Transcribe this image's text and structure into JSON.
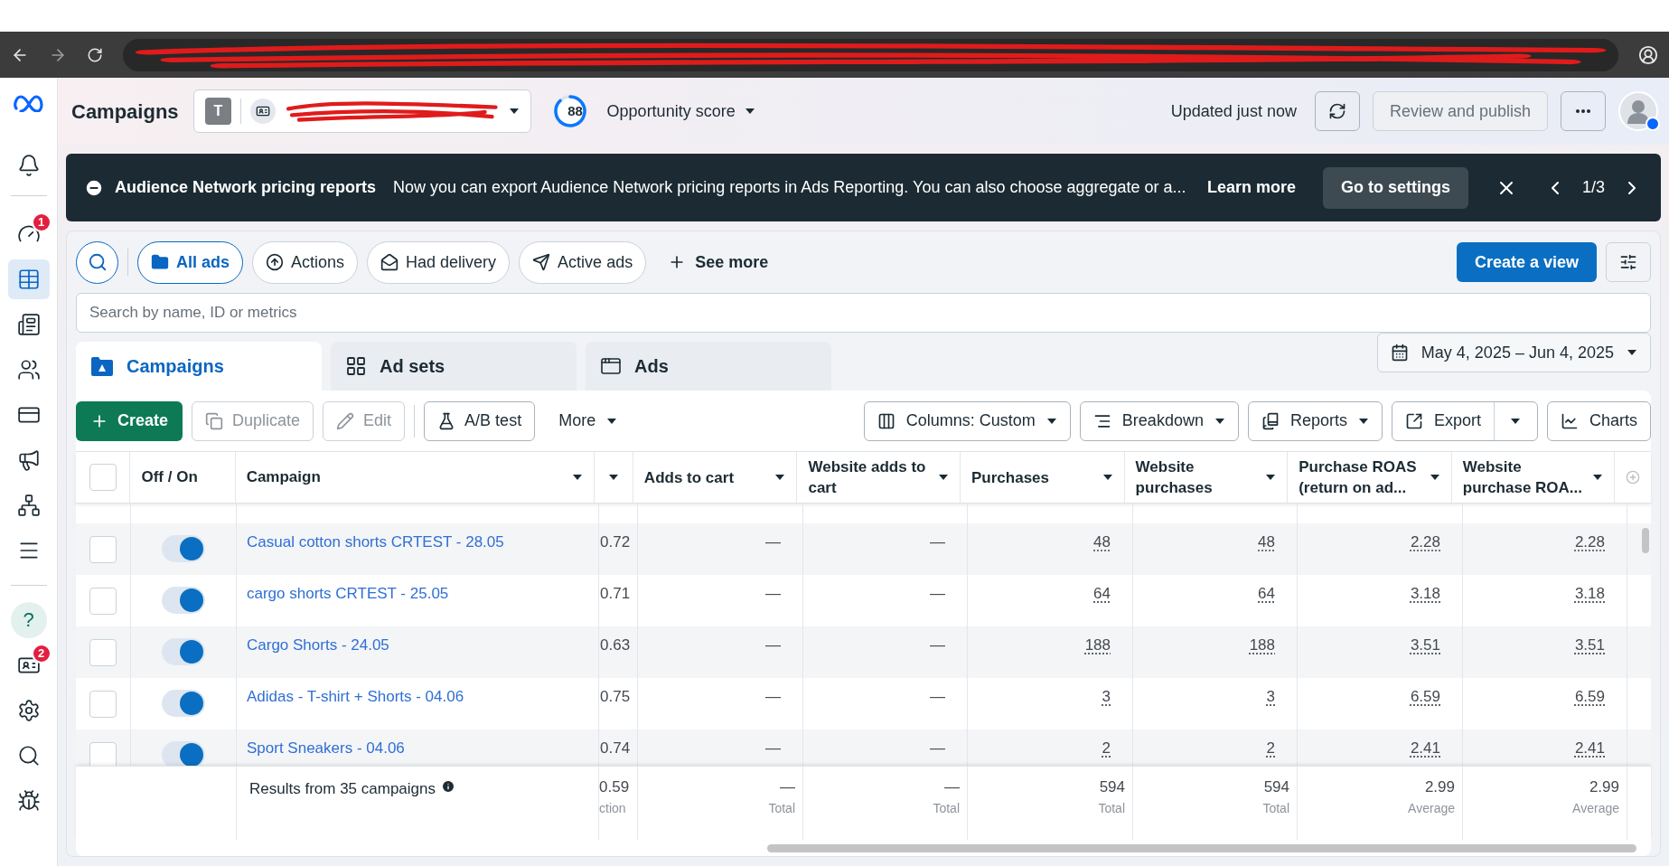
{
  "header": {
    "title": "Campaigns",
    "account": {
      "initial": "T"
    },
    "opportunity": {
      "score": "88",
      "level": 0.88,
      "label": "Opportunity score"
    },
    "updated": "Updated just now",
    "review_button": "Review and publish"
  },
  "sidebar": {
    "items": [
      {
        "kind": "gauge",
        "selected": false,
        "badge": "1"
      },
      {
        "kind": "table",
        "selected": true
      },
      {
        "kind": "pages",
        "selected": false
      },
      {
        "kind": "people",
        "selected": false
      },
      {
        "kind": "card",
        "selected": false
      },
      {
        "kind": "megaphone",
        "selected": false
      },
      {
        "kind": "network",
        "selected": false
      },
      {
        "kind": "menu",
        "selected": false
      }
    ],
    "bottom_items": [
      {
        "kind": "help",
        "selected": false,
        "glyph": "?"
      },
      {
        "kind": "news",
        "selected": false,
        "badge": "2"
      },
      {
        "kind": "settings",
        "selected": false
      },
      {
        "kind": "search",
        "selected": false
      },
      {
        "kind": "bug",
        "selected": false
      }
    ]
  },
  "banner": {
    "title": "Audience Network pricing reports",
    "message": "Now you can export Audience Network pricing reports in Ads Reporting. You can also choose aggregate or a...",
    "link": "Learn more",
    "button": "Go to settings",
    "pager": "1/3"
  },
  "filters": [
    {
      "kind": "folder",
      "label": "All ads",
      "selected": true
    },
    {
      "kind": "actions",
      "label": "Actions",
      "selected": false
    },
    {
      "kind": "delivery",
      "label": "Had delivery",
      "selected": false
    },
    {
      "kind": "active",
      "label": "Active ads",
      "selected": false
    }
  ],
  "see_more": "See more",
  "create_view": "Create a view",
  "search": {
    "placeholder": "Search by name, ID or metrics"
  },
  "level_tabs": [
    {
      "kind": "campaigns",
      "label": "Campaigns",
      "selected": true
    },
    {
      "kind": "adsets",
      "label": "Ad sets",
      "selected": false
    },
    {
      "kind": "ads",
      "label": "Ads",
      "selected": false
    }
  ],
  "date_range": "May 4, 2025 – Jun 4, 2025",
  "toolbar": [
    {
      "kind": "create",
      "label": "Create",
      "disabled": false
    },
    {
      "kind": "duplicate",
      "label": "Duplicate",
      "disabled": true
    },
    {
      "kind": "edit",
      "label": "Edit",
      "disabled": true
    },
    {
      "kind": "abtest",
      "label": "A/B test",
      "disabled": false
    },
    {
      "kind": "more",
      "label": "More",
      "disabled": false
    }
  ],
  "toolbar_right": [
    {
      "kind": "columns",
      "label": "Columns: Custom"
    },
    {
      "kind": "breakdown",
      "label": "Breakdown"
    },
    {
      "kind": "reports",
      "label": "Reports"
    },
    {
      "kind": "export",
      "label": "Export"
    },
    {
      "kind": "charts",
      "label": "Charts"
    }
  ],
  "table": {
    "select_all_checked": false,
    "columns": [
      "Off / On",
      "Campaign",
      "Adds to cart",
      "Website adds to cart",
      "Purchases",
      "Website purchases",
      "Purchase ROAS (return on ad...",
      "Website purchase ROA..."
    ],
    "rows": [
      {
        "name": "Casual cotton shorts CRTEST - 28.05",
        "checked": false,
        "on": true,
        "values": [
          "0.72",
          "—",
          "—",
          "48",
          "48",
          "2.28",
          "2.28"
        ]
      },
      {
        "name": "cargo shorts CRTEST - 25.05",
        "checked": false,
        "on": true,
        "values": [
          "0.71",
          "—",
          "—",
          "64",
          "64",
          "3.18",
          "3.18"
        ]
      },
      {
        "name": "Cargo Shorts - 24.05",
        "checked": false,
        "on": true,
        "values": [
          "0.63",
          "—",
          "—",
          "188",
          "188",
          "3.51",
          "3.51"
        ]
      },
      {
        "name": "Adidas - T-shirt + Shorts - 04.06",
        "checked": false,
        "on": true,
        "values": [
          "0.75",
          "—",
          "—",
          "3",
          "3",
          "6.59",
          "6.59"
        ]
      },
      {
        "name": "Sport Sneakers - 04.06",
        "checked": false,
        "on": true,
        "values": [
          "0.74",
          "—",
          "—",
          "2",
          "2",
          "2.41",
          "2.41"
        ]
      }
    ],
    "footer": {
      "label": "Results from 35 campaigns",
      "cells": [
        {
          "value": "0.59",
          "note": "ction"
        },
        {
          "value": "—",
          "note": "Total"
        },
        {
          "value": "—",
          "note": "Total"
        },
        {
          "value": "594",
          "note": "Total"
        },
        {
          "value": "594",
          "note": "Total"
        },
        {
          "value": "2.99",
          "note": "Average"
        },
        {
          "value": "2.99",
          "note": "Average"
        }
      ]
    }
  }
}
